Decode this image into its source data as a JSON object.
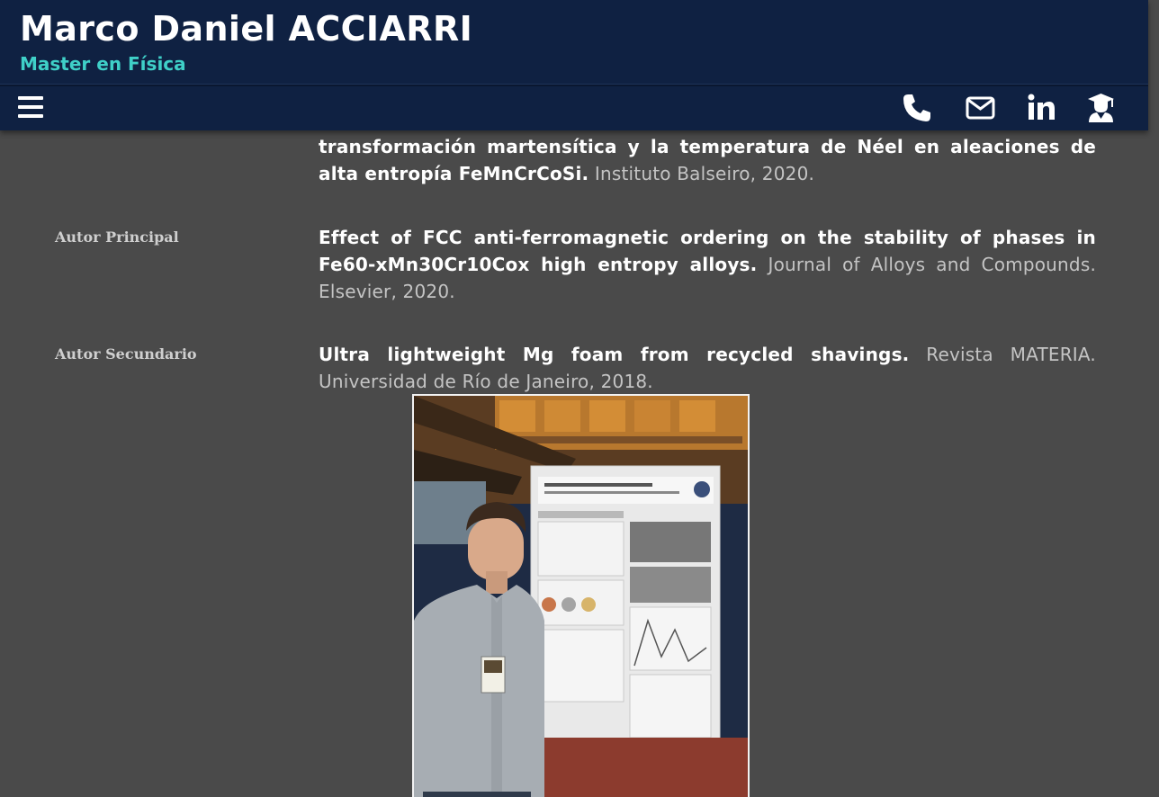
{
  "header": {
    "name": "Marco Daniel ACCIARRI",
    "subtitle": "Master en Física"
  },
  "nav": {
    "icons": [
      "menu-icon",
      "phone-icon",
      "mail-icon",
      "linkedin-icon",
      "scholar-icon"
    ]
  },
  "publications": [
    {
      "role": "",
      "title": "transformación martensítica y la temperatura de Néel en aleaciones de alta entropía FeMnCrCoSi.",
      "venue": "Instituto Balseiro, 2020."
    },
    {
      "role": "Autor Principal",
      "title": "Effect of FCC anti-ferromagnetic ordering on the stability of phases in Fe60-xMn30Cr10Cox high entropy alloys.",
      "venue": "Journal of Alloys and Compounds. Elsevier, 2020."
    },
    {
      "role": "Autor Secundario",
      "title": "Ultra lightweight Mg foam from recycled shavings.",
      "venue": "Revista MATERIA. Universidad de Río de Janeiro, 2018."
    }
  ],
  "colors": {
    "header_bg": "#0f2142",
    "accent": "#3fd0c8",
    "page_bg": "#4a4a4a"
  }
}
